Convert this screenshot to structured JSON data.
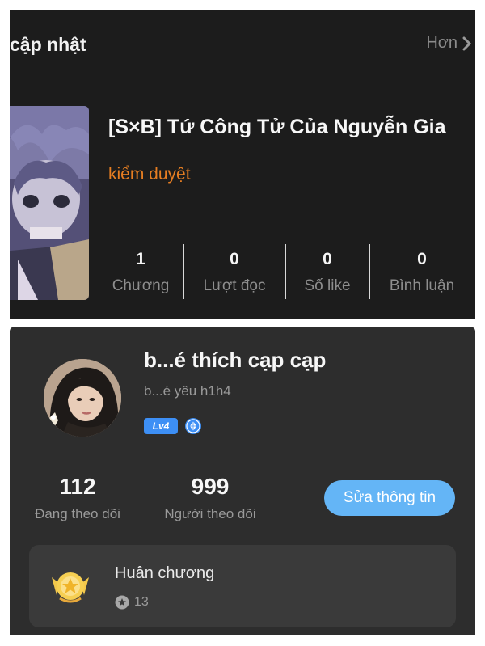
{
  "top_panel": {
    "section_title": "cập nhật",
    "more_label": "Hơn",
    "book": {
      "title": "[S×B] Tứ Công Tử Của Nguyễn Gia",
      "status": "kiểm duyệt"
    },
    "stats": [
      {
        "value": "1",
        "label": "Chương"
      },
      {
        "value": "0",
        "label": "Lượt đọc"
      },
      {
        "value": "0",
        "label": "Số like"
      },
      {
        "value": "0",
        "label": "Bình luận"
      }
    ]
  },
  "profile": {
    "username": "b...é thích cạp cạp",
    "bio": "b...é yêu h1h4",
    "level_badge": "Lv4",
    "following": {
      "count": "112",
      "label": "Đang theo dõi"
    },
    "followers": {
      "count": "999",
      "label": "Người theo dõi"
    },
    "edit_button": "Sửa thông tin",
    "medal": {
      "title": "Huân chương",
      "count": "13",
      "icon": "medal-icon"
    }
  },
  "colors": {
    "status_orange": "#e67e22",
    "button_blue": "#64b5f6",
    "level_blue": "#3d8ff5"
  }
}
